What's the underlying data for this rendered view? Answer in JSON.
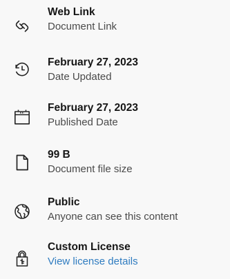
{
  "details": [
    {
      "id": "web-link",
      "title": "Web Link",
      "subtitle": "Document Link",
      "icon": "link-icon"
    },
    {
      "id": "date-updated",
      "title": "February 27, 2023",
      "subtitle": "Date Updated",
      "icon": "history-clock-icon"
    },
    {
      "id": "published-date",
      "title": "February 27, 2023",
      "subtitle": "Published Date",
      "icon": "calendar-icon"
    },
    {
      "id": "file-size",
      "title": "99 B",
      "subtitle": "Document file size",
      "icon": "document-icon"
    },
    {
      "id": "access",
      "title": "Public",
      "subtitle": "Anyone can see this content",
      "icon": "globe-icon"
    },
    {
      "id": "license",
      "title": "Custom License",
      "subtitle": "View license details",
      "icon": "lock-icon"
    }
  ],
  "colors": {
    "background": "#f8f8f8",
    "text": "#151515",
    "secondary_text": "#4a4a4a",
    "link": "#2f7cc0"
  }
}
